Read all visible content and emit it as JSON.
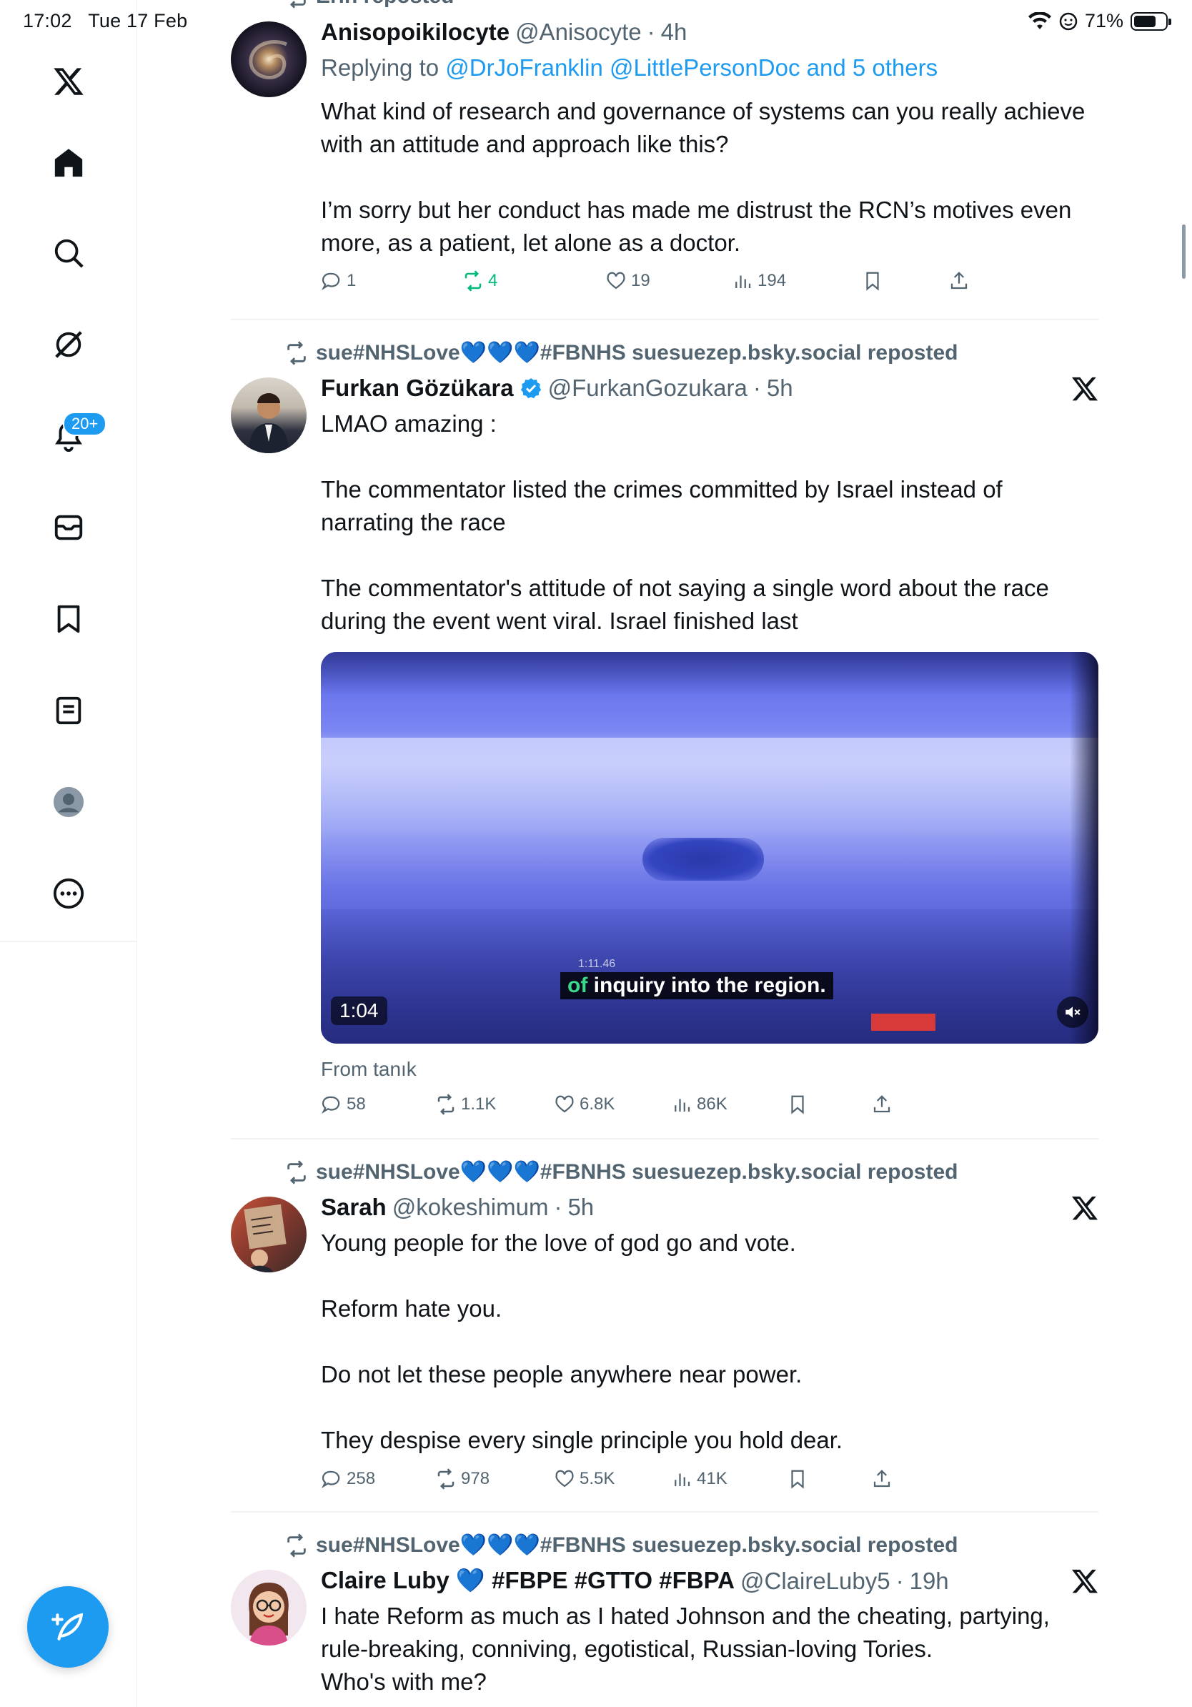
{
  "status": {
    "time": "17:02",
    "date": "Tue 17 Feb",
    "battery": "71%",
    "battery_level": 0.71
  },
  "nav": {
    "notifications_badge": "20+"
  },
  "tweets": [
    {
      "repost_line": "Erin reposted",
      "name": "Anisopoikilocyte",
      "handle": "@Anisocyte",
      "time": "4h",
      "replying_prefix": "Replying to",
      "replying_to": "@DrJoFranklin @LittlePersonDoc and 5 others",
      "text": "What kind of research and governance of systems can you really achieve with an attitude and approach like this?\n\nI’m sorry but her conduct has made me distrust the RCN’s motives even more, as a patient, let alone as a doctor.",
      "replies": "1",
      "reposts": "4",
      "likes": "19",
      "views": "194"
    },
    {
      "repost_line": "sue#NHSLove💙💙💙#FBNHS suesuezep.bsky.social reposted",
      "name": "Furkan Gözükara",
      "handle": "@FurkanGozukara",
      "time": "5h",
      "text": "LMAO amazing :\n\nThe commentator listed the crimes committed by Israel instead of narrating the race\n\nThe commentator's attitude of not saying a single word about the race during the event went viral. Israel finished last",
      "media": {
        "caption_highlight": "of",
        "caption_rest": " inquiry into the region.",
        "duration": "1:04",
        "ticker": "1:11.46"
      },
      "from": "From tanık",
      "replies": "58",
      "reposts": "1.1K",
      "likes": "6.8K",
      "views": "86K"
    },
    {
      "repost_line": "sue#NHSLove💙💙💙#FBNHS suesuezep.bsky.social reposted",
      "name": "Sarah",
      "handle": "@kokeshimum",
      "time": "5h",
      "text": "Young people for the love of god go and vote.\n\nReform hate you.\n\nDo not let these people anywhere near power.\n\nThey despise every single principle you hold dear.",
      "replies": "258",
      "reposts": "978",
      "likes": "5.5K",
      "views": "41K"
    },
    {
      "repost_line": "sue#NHSLove💙💙💙#FBNHS suesuezep.bsky.social reposted",
      "name": "Claire Luby 💙 #FBPE #GTTO #FBPA",
      "handle": "@ClaireLuby5",
      "time": "19h",
      "text": "I hate Reform as much as I hated Johnson and the cheating, partying, rule-breaking, conniving, egotistical, Russian-loving Tories.\nWho's with me?"
    }
  ],
  "colors": {
    "accent": "#1d9bf0",
    "repost_green": "#00ba7c",
    "muted": "#536471"
  },
  "icons": [
    "x-logo-icon",
    "home-icon",
    "search-icon",
    "grok-icon",
    "bell-icon",
    "mail-icon",
    "bookmark-icon",
    "list-icon",
    "profile-icon",
    "more-icon",
    "compose-icon"
  ]
}
